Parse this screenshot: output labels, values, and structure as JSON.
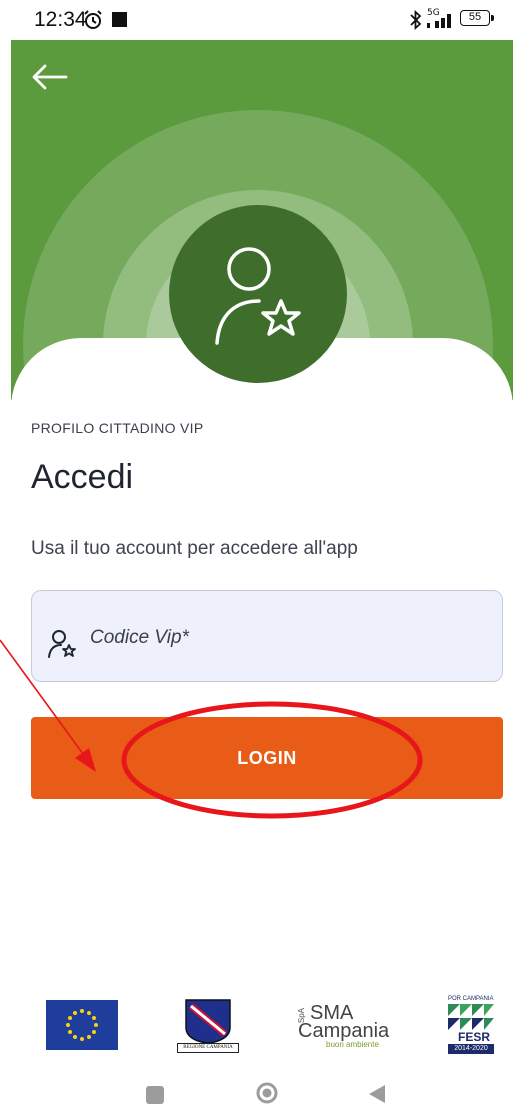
{
  "status_bar": {
    "time": "12:34",
    "network": "5G",
    "battery": "55",
    "icons": [
      "alarm-icon",
      "bluetooth-icon",
      "signal-icon",
      "battery-icon"
    ]
  },
  "header": {
    "back_icon": "arrow-left-icon",
    "avatar_icon": "user-star-icon",
    "colors": {
      "background": "#5b9a3d",
      "avatar": "#3f6e2c"
    }
  },
  "login": {
    "eyebrow": "PROFILO CITTADINO VIP",
    "title": "Accedi",
    "subtitle": "Usa il tuo account per accedere all'app",
    "vip_field": {
      "value": "",
      "placeholder": "Codice Vip*",
      "icon": "user-star-icon"
    },
    "button_label": "LOGIN",
    "colors": {
      "button": "#e85c17",
      "field_bg": "#eef0fb"
    }
  },
  "footer": {
    "logos": [
      "eu-flag-logo",
      "regione-campania-logo",
      "sma-campania-logo",
      "por-fesr-logo"
    ],
    "region_caption": "REGIONE CAMPANIA",
    "sma": {
      "spa": "SpA",
      "name": "SMA",
      "campania": "Campania",
      "tagline": "buon ambiente"
    },
    "fesr": {
      "top": "POR CAMPANIA",
      "label": "FESR",
      "years": "2014-2020"
    }
  },
  "nav_bar": {
    "icons": [
      "recents-icon",
      "home-icon",
      "back-icon"
    ]
  }
}
